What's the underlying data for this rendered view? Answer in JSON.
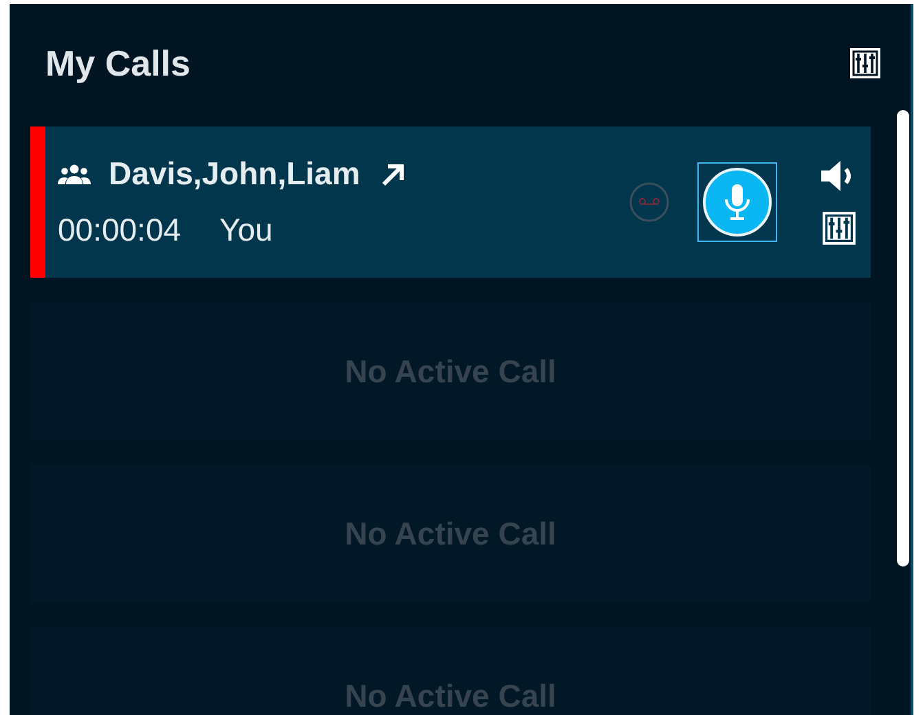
{
  "panel": {
    "title": "My Calls"
  },
  "calls": [
    {
      "kind": "active",
      "name": "Davis,John,Liam",
      "timer": "00:00:04",
      "speaker": "You"
    },
    {
      "kind": "empty",
      "text": "No Active Call"
    },
    {
      "kind": "empty",
      "text": "No Active Call"
    },
    {
      "kind": "empty",
      "text": "No Active Call"
    }
  ]
}
